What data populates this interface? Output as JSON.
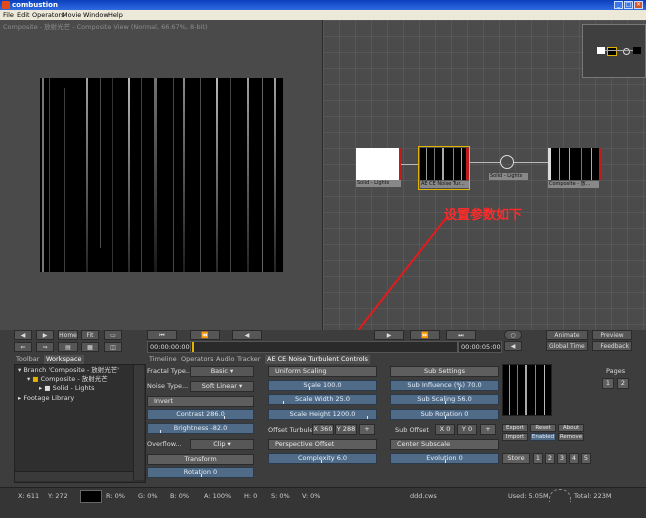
{
  "window": {
    "title": "combustion",
    "min": "_",
    "max": "□",
    "close": "×"
  },
  "menu": [
    "File",
    "Edit",
    "Operators",
    "Movie",
    "Window",
    "Help"
  ],
  "viewer": {
    "caption": "Composite - 放射光芒 - Composite View (Normal, 66.67%, 8-bit)"
  },
  "schematic": {
    "nodes": [
      "Solid - Lights",
      "AE CE Noise Tur...",
      "Solid - Lights",
      "Composite - 放..."
    ],
    "annotation": "设置参数如下"
  },
  "toolbar": {
    "home": "Home",
    "fit": "Fit",
    "timecode_start": "00:00:00:00",
    "timecode_end": "00:00:05:00",
    "animate": "Animate",
    "preview": "Preview",
    "global_time": "Global Time",
    "feedback": "Feedback"
  },
  "tabs": {
    "left": [
      "Toolbar",
      "Workspace"
    ],
    "main": [
      "Timeline",
      "Operators",
      "Audio",
      "Tracker"
    ],
    "active": "AE CE Noise Turbulent Controls"
  },
  "workspace": {
    "items": [
      "Branch 'Composite - 放射光芒'",
      "Composite - 放射光芒",
      "Solid - Lights",
      "Footage Library"
    ]
  },
  "controls": {
    "fractal_type_label": "Fractal Type...",
    "fractal_type_value": "Basic",
    "noise_type_label": "Noise Type...",
    "noise_type_value": "Soft Linear",
    "invert": "Invert",
    "contrast": "Contrast 286.0",
    "brightness": "Brightness -82.0",
    "overflow_label": "Overflow...",
    "overflow_value": "Clip",
    "transform": "Transform",
    "rotation": "Rotation 0",
    "uniform_scaling": "Uniform Scaling",
    "scale": "Scale 100.0",
    "scale_width": "Scale Width 25.0",
    "scale_height": "Scale Height 1200.0",
    "offset_turbulence": "Offset Turbule",
    "offset_x": "X 360",
    "offset_y": "Y 288",
    "perspective_offset": "Perspective Offset",
    "complexity": "Complexity 6.0",
    "sub_settings": "Sub Settings",
    "sub_influence": "Sub Influence (%) 70.0",
    "sub_scaling": "Sub Scaling 56.0",
    "sub_rotation": "Sub Rotation 0",
    "sub_offset": "Sub Offset",
    "sub_offset_x": "X 0",
    "sub_offset_y": "Y 0",
    "center_subscale": "Center Subscale",
    "evolution": "Evolution 0",
    "plus": "+"
  },
  "side": {
    "export": "Export",
    "reset": "Reset",
    "about": "About",
    "import": "Import",
    "enabled": "Enabled",
    "remove": "Remove",
    "store": "Store",
    "store_slots": [
      "1",
      "2",
      "3",
      "4",
      "5"
    ],
    "pages": "Pages",
    "page_slots": [
      "1",
      "2"
    ]
  },
  "status": {
    "x": "X: 611",
    "y": "Y: 272",
    "r": "R: 0%",
    "g": "G: 0%",
    "b": "B: 0%",
    "a": "A: 100%",
    "h": "H: 0",
    "s": "S: 0%",
    "v": "V: 0%",
    "file": "ddd.cws",
    "used": "Used: 5.05M",
    "total": "Total: 223M"
  },
  "colors": {
    "accent": "#4f6b88",
    "annotation": "#ff2a2a",
    "titlebar": "#2f6ae0"
  }
}
